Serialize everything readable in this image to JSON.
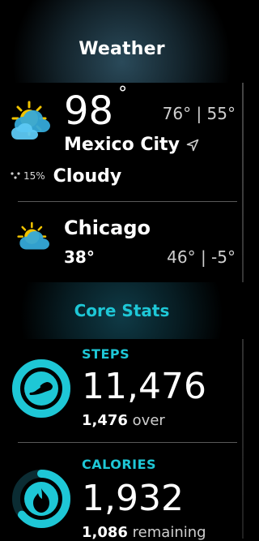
{
  "header": {
    "title": "Weather"
  },
  "weather": {
    "primary": {
      "temperature": "98",
      "degree": "°",
      "hi_lo": "76° | 55°",
      "city": "Mexico City",
      "humidity": "15%",
      "condition": "Cloudy",
      "icon": "partly-cloudy-sun-icon",
      "location_icon": "navigation-arrow-icon"
    },
    "secondary": {
      "city": "Chicago",
      "temperature": "38°",
      "hi_lo": "46° | -5°",
      "icon": "partly-cloudy-sun-icon"
    }
  },
  "core": {
    "title": "Core Stats",
    "steps": {
      "label": "STEPS",
      "value": "11,476",
      "sub_number": "1,476",
      "sub_text": "over",
      "progress": 1.15,
      "icon": "shoe-icon",
      "accent": "#1ec7d6"
    },
    "calories": {
      "label": "CALORIES",
      "value": "1,932",
      "sub_number": "1,086",
      "sub_text": "remaining",
      "progress": 0.64,
      "icon": "flame-icon",
      "accent": "#1ec7d6"
    }
  },
  "colors": {
    "accent": "#1ec7d6",
    "sun": "#f2c400",
    "cloud": "#35a9d8"
  }
}
